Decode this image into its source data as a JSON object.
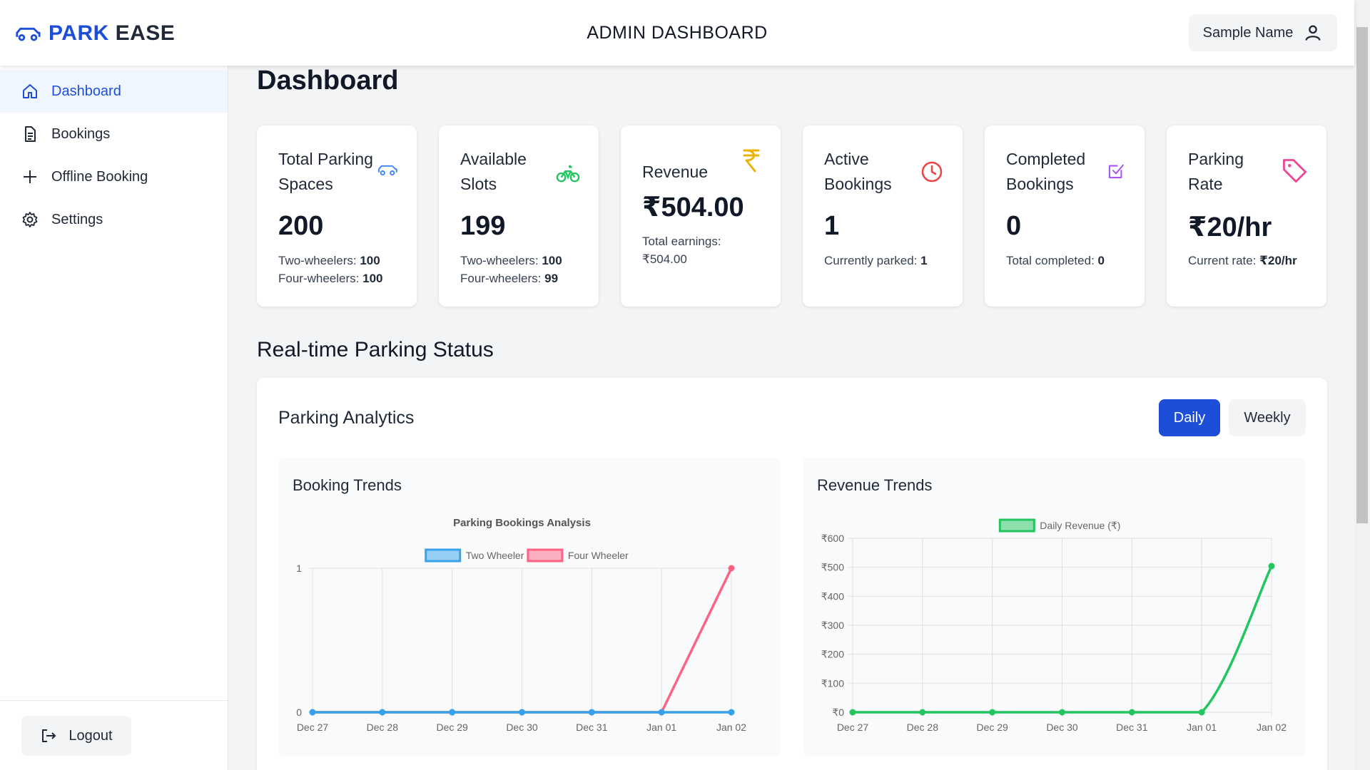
{
  "header": {
    "brand_part1": "PARK",
    "brand_part2": "EASE",
    "title": "ADMIN DASHBOARD",
    "user_name": "Sample Name"
  },
  "sidebar": {
    "items": [
      {
        "label": "Dashboard",
        "icon": "home-icon",
        "active": true
      },
      {
        "label": "Bookings",
        "icon": "document-icon",
        "active": false
      },
      {
        "label": "Offline Booking",
        "icon": "plus-icon",
        "active": false
      },
      {
        "label": "Settings",
        "icon": "gear-icon",
        "active": false
      }
    ],
    "logout_label": "Logout"
  },
  "main": {
    "page_title": "Dashboard",
    "cards": [
      {
        "label": "Total Parking Spaces",
        "value": "200",
        "sub1_label": "Two-wheelers:",
        "sub1_value": "100",
        "sub2_label": "Four-wheelers:",
        "sub2_value": "100",
        "icon": "car-icon",
        "color": "#3b82f6"
      },
      {
        "label": "Available Slots",
        "value": "199",
        "sub1_label": "Two-wheelers:",
        "sub1_value": "100",
        "sub2_label": "Four-wheelers:",
        "sub2_value": "99",
        "icon": "bicycle-icon",
        "color": "#22c55e"
      },
      {
        "label": "Revenue",
        "value": "₹504.00",
        "sub1_label": "Total earnings:",
        "sub1_value": "₹504.00",
        "icon": "rupee-icon",
        "color": "#eab308"
      },
      {
        "label": "Active Bookings",
        "value": "1",
        "sub1_label": "Currently parked:",
        "sub1_value": "1",
        "icon": "clock-icon",
        "color": "#ef4444"
      },
      {
        "label": "Completed Bookings",
        "value": "0",
        "sub1_label": "Total completed:",
        "sub1_value": "0",
        "icon": "check-square-icon",
        "color": "#a855f7"
      },
      {
        "label": "Parking Rate",
        "value": "₹20/hr",
        "sub1_label": "Current rate:",
        "sub1_value": "₹20/hr",
        "icon": "tag-icon",
        "color": "#ec4899"
      }
    ],
    "section_title": "Real-time Parking Status",
    "panel_title": "Parking Analytics",
    "toggle_daily": "Daily",
    "toggle_weekly": "Weekly",
    "booking_chart_title": "Booking Trends",
    "revenue_chart_title": "Revenue Trends"
  },
  "chart_data": [
    {
      "type": "line",
      "title": "Parking Bookings Analysis",
      "categories": [
        "Dec 27",
        "Dec 28",
        "Dec 29",
        "Dec 30",
        "Dec 31",
        "Jan 01",
        "Jan 02"
      ],
      "series": [
        {
          "name": "Two Wheeler",
          "values": [
            0,
            0,
            0,
            0,
            0,
            0,
            0
          ],
          "color": "#36a2eb"
        },
        {
          "name": "Four Wheeler",
          "values": [
            0,
            0,
            0,
            0,
            0,
            0,
            1
          ],
          "color": "#ff6384"
        }
      ],
      "ylim": [
        0,
        1
      ],
      "yticks": [
        "0",
        "1"
      ],
      "grid": true,
      "legend": "top"
    },
    {
      "type": "line",
      "title": "",
      "categories": [
        "Dec 27",
        "Dec 28",
        "Dec 29",
        "Dec 30",
        "Dec 31",
        "Jan 01",
        "Jan 02"
      ],
      "series": [
        {
          "name": "Daily Revenue (₹)",
          "values": [
            0,
            0,
            0,
            0,
            0,
            0,
            504
          ],
          "color": "#22c55e"
        }
      ],
      "ylim": [
        0,
        600
      ],
      "yticks": [
        "₹0",
        "₹100",
        "₹200",
        "₹300",
        "₹400",
        "₹500",
        "₹600"
      ],
      "grid": true,
      "legend": "top"
    }
  ]
}
